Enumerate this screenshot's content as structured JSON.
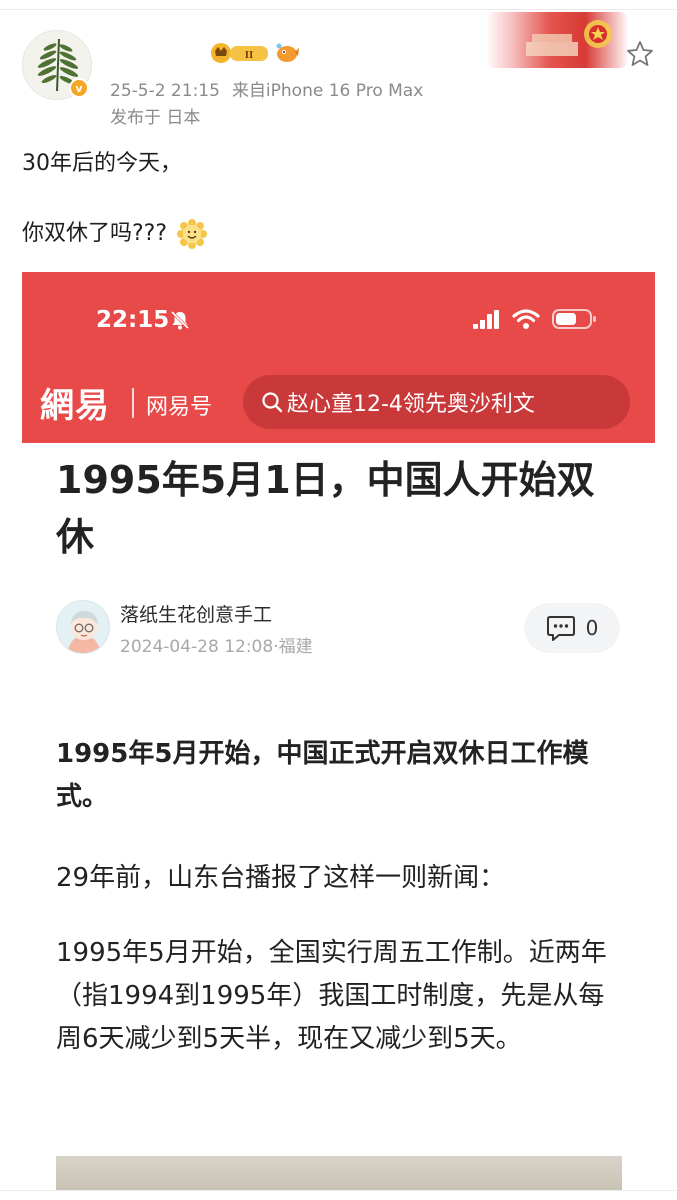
{
  "post": {
    "timestamp": "25-5-2 21:15",
    "source": "来自iPhone 16 Pro Max",
    "location": "发布于 日本",
    "badge_level": "II",
    "verified_mark": "v",
    "lines": [
      "30年后的今天，",
      "你双休了吗???"
    ],
    "icons": {
      "avatar": "fern-avatar",
      "favorite": "star-icon",
      "emoji": "smile-emoji-icon"
    }
  },
  "embedded": {
    "status_time": "22:15",
    "brand_logo": "網易",
    "brand_sub": "网易号",
    "search_text": "赵心童12-4领先奥沙利文",
    "header_color": "#e84a4a",
    "article": {
      "title": "1995年5月1日，中国人开始双休",
      "author": "落纸生花创意手工",
      "author_meta": "2024-04-28 12:08·福建",
      "comment_count": "0",
      "paragraphs": [
        "1995年5月开始，中国正式开启双休日工作模式。",
        "29年前，山东台播报了这样一则新闻：",
        "1995年5月开始，全国实行周五工作制。近两年（指1994到1995年）我国工时制度，先是从每周6天减少到5天半，现在又减少到5天。"
      ]
    }
  }
}
